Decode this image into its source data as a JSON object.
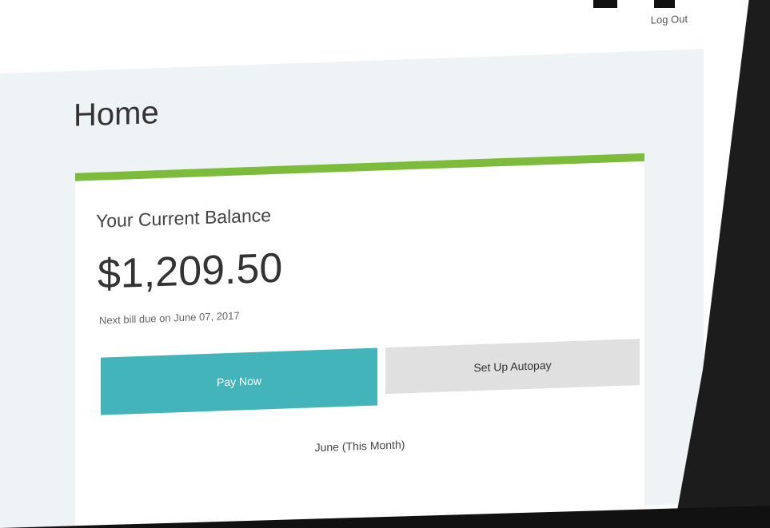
{
  "header": {
    "logout_label": "Log Out"
  },
  "page": {
    "title": "Home"
  },
  "balance_card": {
    "heading": "Your Current Balance",
    "amount": "$1,209.50",
    "due_note": "Next bill due on June 07, 2017",
    "pay_now_label": "Pay Now",
    "autopay_label": "Set Up Autopay",
    "month_label": "June (This Month)"
  },
  "colors": {
    "accent_bar": "#7dbb3b",
    "pay_button": "#44b4bb",
    "autopay_button": "#e0e0e0",
    "content_background": "#eef3f6"
  }
}
